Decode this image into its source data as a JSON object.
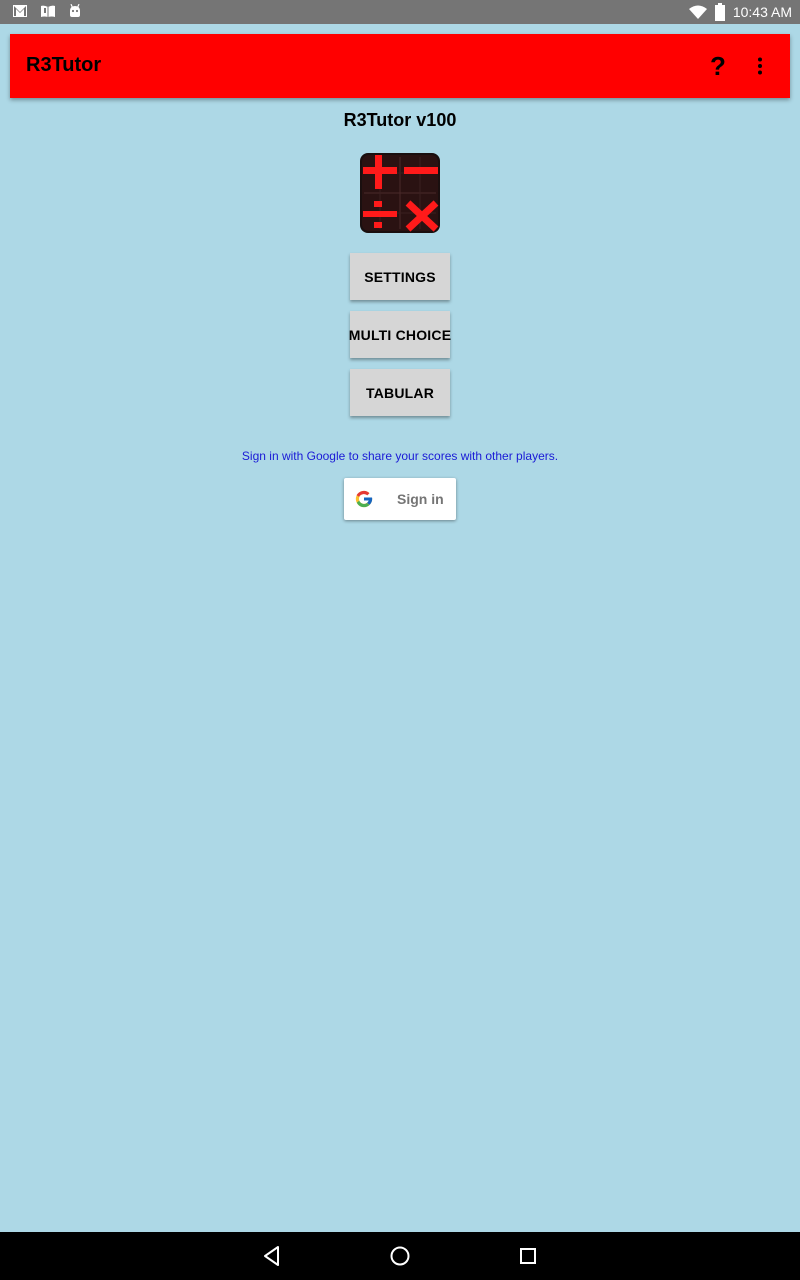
{
  "status_bar": {
    "time": "10:43 AM",
    "left_icons": [
      "gmail-icon",
      "book-icon",
      "android-icon"
    ],
    "right_icons": [
      "wifi-icon",
      "battery-icon"
    ]
  },
  "app_bar": {
    "title": "R3Tutor",
    "help_label": "?",
    "background_color": "#ff0000",
    "actions": [
      "help-icon",
      "overflow-menu-icon"
    ]
  },
  "main": {
    "version_title": "R3Tutor v100",
    "logo_icon": "math-operators-logo",
    "buttons": [
      {
        "label": "SETTINGS"
      },
      {
        "label": "MULTI CHOICE"
      },
      {
        "label": "TABULAR"
      }
    ],
    "signin_prompt": "Sign in with Google to share your scores with other players.",
    "signin_button": "Sign in",
    "background_color": "#add8e6"
  },
  "nav_bar": {
    "buttons": [
      "back-icon",
      "home-icon",
      "recent-apps-icon"
    ]
  }
}
